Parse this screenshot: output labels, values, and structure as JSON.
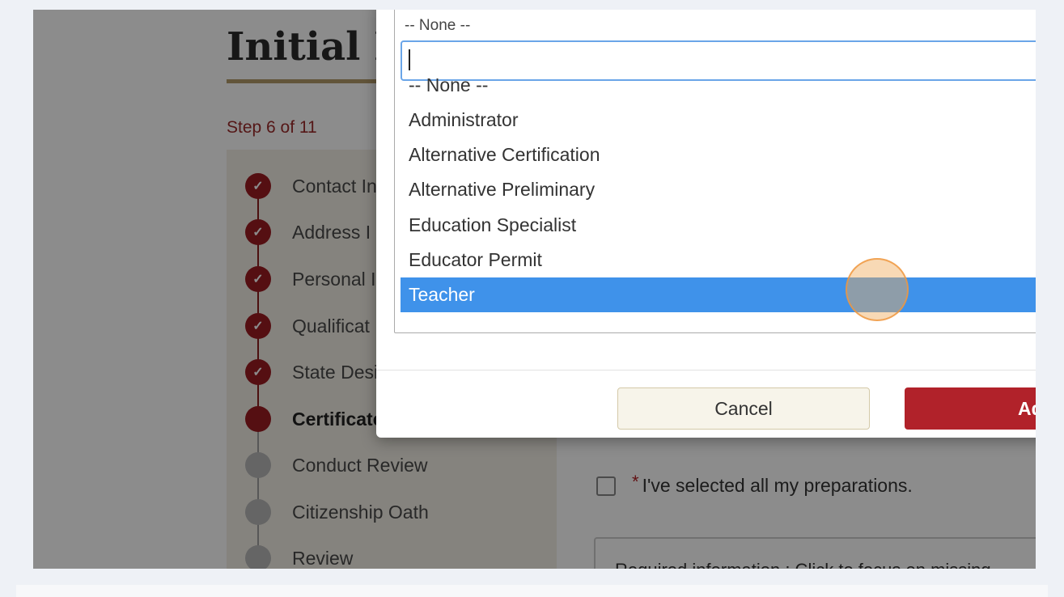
{
  "page": {
    "title": "Initial E",
    "step_counter": "Step 6 of 11",
    "steps": [
      {
        "label": "Contact In",
        "status": "done"
      },
      {
        "label": "Address I",
        "status": "done"
      },
      {
        "label": "Personal I",
        "status": "done"
      },
      {
        "label": "Qualificat",
        "status": "done"
      },
      {
        "label": "State Desi",
        "status": "done"
      },
      {
        "label": "Certificate",
        "status": "current"
      },
      {
        "label": "Conduct Review",
        "status": "todo"
      },
      {
        "label": "Citizenship Oath",
        "status": "todo"
      },
      {
        "label": "Review",
        "status": "todo"
      }
    ],
    "step_check_glyph": "✓",
    "confirm_label": "I've selected all my preparations.",
    "required_star": "*",
    "required_info_text": "Required information : Click to focus on missing"
  },
  "modal": {
    "dropdown": {
      "selected_value": "-- None --",
      "search_value": "",
      "options": [
        "-- None --",
        "Administrator",
        "Alternative Certification",
        "Alternative Preliminary",
        "Education Specialist",
        "Educator Permit",
        "Teacher"
      ],
      "highlighted": "Teacher"
    },
    "cancel_label": "Cancel",
    "add_label": "Ad"
  },
  "colors": {
    "brand_red": "#9b1c22",
    "highlight_blue": "#3f92ea",
    "accent_gold": "#b29c6a"
  }
}
